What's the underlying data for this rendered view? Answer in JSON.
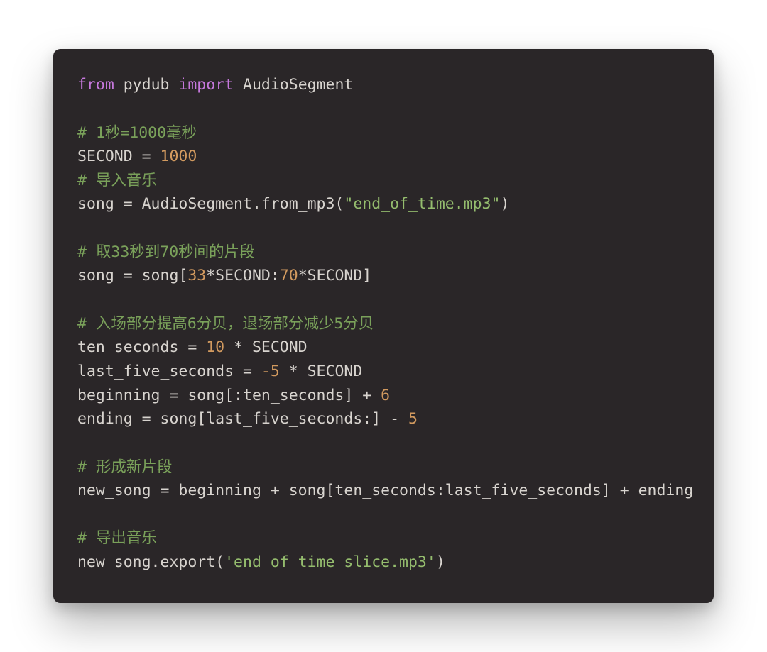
{
  "code": {
    "l1": {
      "kw1": "from",
      "mod": "pydub",
      "kw2": "import",
      "cls": "AudioSegment"
    },
    "c1": "# 1秒=1000毫秒",
    "l2": {
      "var": "SECOND",
      "eq": " = ",
      "num": "1000"
    },
    "c2": "# 导入音乐",
    "l3": {
      "pre": "song = AudioSegment.from_mp3(",
      "str": "\"end_of_time.mp3\"",
      "post": ")"
    },
    "c3": "# 取33秒到70秒间的片段",
    "l4": {
      "a": "song = song[",
      "n1": "33",
      "b": "*SECOND:",
      "n2": "70",
      "c": "*SECOND]"
    },
    "c4": "# 入场部分提高6分贝，退场部分减少5分贝",
    "l5": {
      "a": "ten_seconds = ",
      "n1": "10",
      "b": " * SECOND"
    },
    "l6": {
      "a": "last_five_seconds = ",
      "n1": "-5",
      "b": " * SECOND"
    },
    "l7": {
      "a": "beginning = song[:ten_seconds] + ",
      "n1": "6"
    },
    "l8": {
      "a": "ending = song[last_five_seconds:] - ",
      "n1": "5"
    },
    "c5": "# 形成新片段",
    "l9": "new_song = beginning + song[ten_seconds:last_five_seconds] + ending",
    "c6": "# 导出音乐",
    "l10": {
      "a": "new_song.export(",
      "str": "'end_of_time_slice.mp3'",
      "b": ")"
    }
  }
}
